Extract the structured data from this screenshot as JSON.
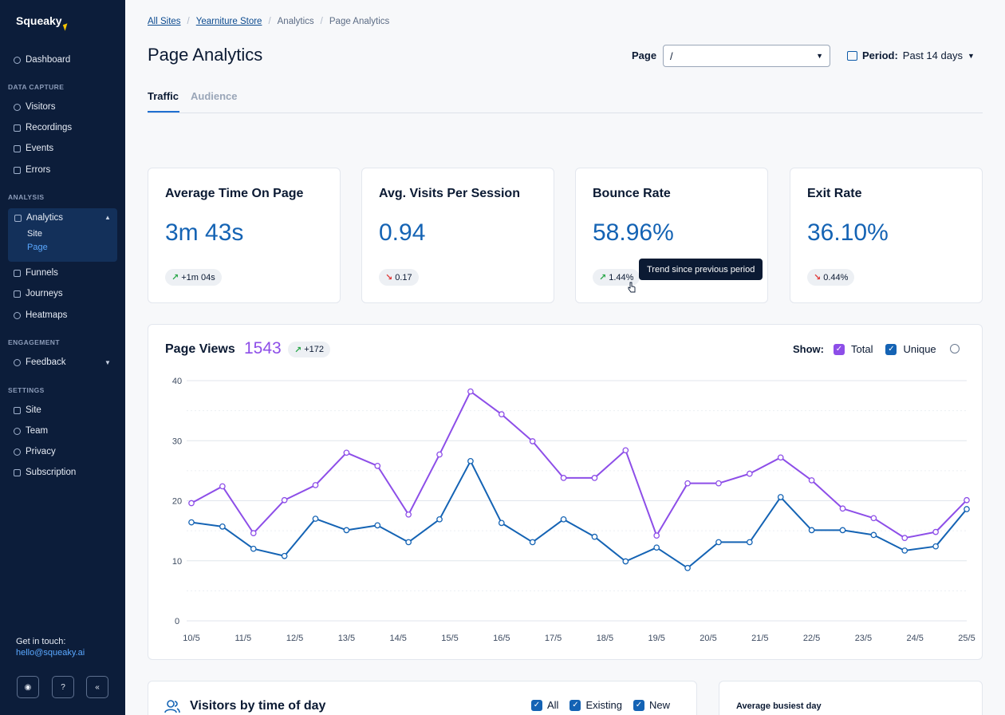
{
  "sidebar": {
    "logo": "Squeaky",
    "items": [
      {
        "label": "Dashboard"
      },
      {
        "label": "Visitors"
      },
      {
        "label": "Recordings"
      },
      {
        "label": "Events"
      },
      {
        "label": "Errors"
      },
      {
        "label": "Analytics"
      },
      {
        "label": "Funnels"
      },
      {
        "label": "Journeys"
      },
      {
        "label": "Heatmaps"
      },
      {
        "label": "Feedback"
      },
      {
        "label": "Site"
      },
      {
        "label": "Team"
      },
      {
        "label": "Privacy"
      },
      {
        "label": "Subscription"
      }
    ],
    "sections": {
      "data_capture": "DATA CAPTURE",
      "analysis": "ANALYSIS",
      "engagement": "ENGAGEMENT",
      "settings": "SETTINGS"
    },
    "analytics_sub": [
      "Site",
      "Page"
    ],
    "touch_label": "Get in touch:",
    "touch_email": "hello@squeaky.ai"
  },
  "breadcrumb": [
    "All Sites",
    "Yearniture Store",
    "Analytics",
    "Page Analytics"
  ],
  "header": {
    "title": "Page Analytics",
    "page_label": "Page",
    "page_value": "/",
    "period_label": "Period:",
    "period_value": "Past 14 days"
  },
  "tabs": [
    "Traffic",
    "Audience"
  ],
  "kpis": [
    {
      "title": "Average Time On Page",
      "value": "3m 43s",
      "trend": "+1m 04s",
      "direction": "up"
    },
    {
      "title": "Avg. Visits Per Session",
      "value": "0.94",
      "trend": "0.17",
      "direction": "down"
    },
    {
      "title": "Bounce Rate",
      "value": "58.96%",
      "trend": "1.44%",
      "direction": "up"
    },
    {
      "title": "Exit Rate",
      "value": "36.10%",
      "trend": "0.44%",
      "direction": "down"
    }
  ],
  "tooltip": "Trend since previous period",
  "page_views": {
    "title": "Page Views",
    "total": "1543",
    "trend": "+172",
    "show_label": "Show:",
    "total_label": "Total",
    "unique_label": "Unique"
  },
  "chart_data": {
    "type": "line",
    "x": [
      "10/5",
      "",
      "11/5",
      "",
      "12/5",
      "",
      "13/5",
      "",
      "14/5",
      "",
      "15/5",
      "",
      "16/5",
      "",
      "17/5",
      "",
      "18/5",
      "",
      "19/5",
      "",
      "20/5",
      "",
      "21/5",
      "",
      "22/5",
      "",
      "23/5",
      "",
      "24/5",
      "",
      "25/5"
    ],
    "x_tick_labels": [
      "10/5",
      "11/5",
      "12/5",
      "13/5",
      "14/5",
      "15/5",
      "16/5",
      "17/5",
      "18/5",
      "19/5",
      "20/5",
      "21/5",
      "22/5",
      "23/5",
      "24/5",
      "25/5"
    ],
    "series": [
      {
        "name": "Total",
        "color": "#8d4ee8",
        "values": [
          19.6,
          22.4,
          14.6,
          20.1,
          22.6,
          28.0,
          25.8,
          17.7,
          27.7,
          38.2,
          34.4,
          29.9,
          23.8,
          23.8,
          28.4,
          14.2,
          22.9,
          22.9,
          24.5,
          27.2,
          23.4,
          18.7,
          17.1,
          13.8,
          14.8,
          20.1
        ]
      },
      {
        "name": "Unique",
        "color": "#1463b4",
        "values": [
          16.4,
          15.7,
          12.0,
          10.8,
          17.0,
          15.1,
          15.9,
          13.1,
          16.9,
          26.6,
          16.3,
          13.1,
          16.9,
          14.0,
          9.9,
          12.2,
          8.8,
          13.1,
          13.1,
          20.6,
          15.1,
          15.1,
          14.3,
          11.7,
          12.4,
          18.6
        ]
      }
    ],
    "yticks": [
      0,
      10,
      20,
      30,
      40
    ],
    "ylim": [
      0,
      40
    ],
    "grid": true
  },
  "bottom": {
    "visitors_title": "Visitors by time of day",
    "checks": [
      "All",
      "Existing",
      "New"
    ],
    "busiest_label": "Average busiest day"
  }
}
